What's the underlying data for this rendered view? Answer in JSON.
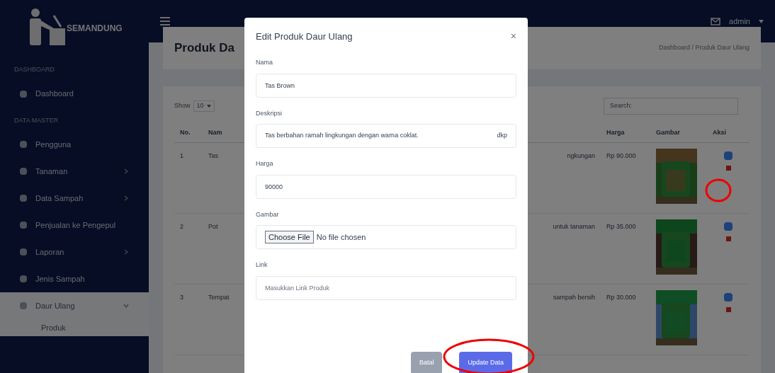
{
  "brand": "SEMANDUNG",
  "sidebar": {
    "sections": [
      {
        "heading": "DASHBOARD",
        "items": [
          {
            "label": "Dashboard",
            "selected": false
          }
        ]
      },
      {
        "heading": "DATA MASTER",
        "items": [
          {
            "label": "Pengguna",
            "selected": false
          },
          {
            "label": "Tanaman",
            "expanded": false,
            "selected": false
          },
          {
            "label": "Data Sampah",
            "expanded": false,
            "selected": false
          },
          {
            "label": "Penjualan ke Pengepul",
            "selected": false
          },
          {
            "label": "Laporan",
            "expanded": false,
            "selected": false
          },
          {
            "label": "Jenis Sampah",
            "selected": false
          },
          {
            "label": "Daur Ulang",
            "expanded": true,
            "selected": true,
            "children": [
              "Produk"
            ]
          }
        ]
      }
    ]
  },
  "topbar": {
    "user": "admin"
  },
  "page": {
    "title": "Produk Da",
    "breadcrumb": "Dashboard / Produk Daur Ulang",
    "show_label": "Show",
    "page_size": "10",
    "search_label": "Search:",
    "table": {
      "columns": [
        "No.",
        "Nam",
        "Harga",
        "Gambar",
        "Aksi"
      ],
      "rows": [
        {
          "no": "1",
          "name": "Tas",
          "desc": "ngkungan",
          "price": "Rp 90.000"
        },
        {
          "no": "2",
          "name": "Pot",
          "desc": "untuk tanaman",
          "price": "Rp 35.000"
        },
        {
          "no": "3",
          "name": "Tempat",
          "desc": "sampah bersih",
          "price": "Rp 30.000"
        }
      ]
    }
  },
  "modal": {
    "title": "Edit Produk Daur Ulang",
    "close": "×",
    "fields": [
      {
        "kind": "text",
        "label": "Nama",
        "value": "Tas Brown"
      },
      {
        "kind": "textarea",
        "label": "Deskripsi",
        "value": "Tas berbahan ramah lingkungan dengan warna coklat.",
        "extra": "dkp"
      },
      {
        "kind": "text",
        "label": "Harga",
        "value": "90000"
      },
      {
        "kind": "file",
        "label": "Gambar",
        "button": "Choose File",
        "status": "No file chosen"
      },
      {
        "kind": "text",
        "label": "Link",
        "placeholder": "Masukkan Link Produk"
      }
    ],
    "buttons": [
      {
        "label": "Batal",
        "kind": "secondary"
      },
      {
        "label": "Update Data",
        "kind": "primary"
      }
    ]
  }
}
